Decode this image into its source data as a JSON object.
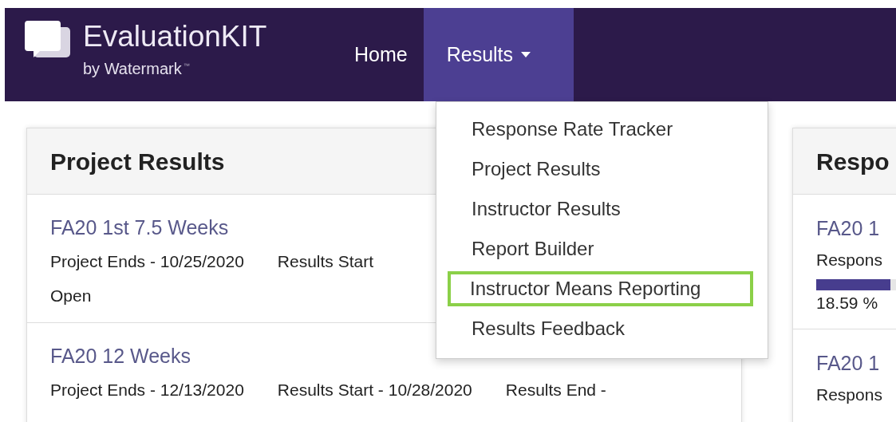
{
  "brand": {
    "name": "EvaluationKIT",
    "byline": "by Watermark",
    "trademark": "™"
  },
  "nav": [
    {
      "label": "Home",
      "selected": false,
      "dropdown": false
    },
    {
      "label": "Results",
      "selected": true,
      "dropdown": true
    }
  ],
  "dropdown_menu": [
    {
      "label": "Response Rate Tracker",
      "highlighted": false
    },
    {
      "label": "Project Results",
      "highlighted": false
    },
    {
      "label": "Instructor Results",
      "highlighted": false
    },
    {
      "label": "Report Builder",
      "highlighted": false
    },
    {
      "label": "Instructor Means Reporting",
      "highlighted": true
    },
    {
      "label": "Results Feedback",
      "highlighted": false
    }
  ],
  "project_results": {
    "title": "Project Results",
    "rows": [
      {
        "name": "FA20 1st 7.5 Weeks",
        "details": [
          "Project Ends - 10/25/2020",
          "Results Start"
        ],
        "status": "Open"
      },
      {
        "name": "FA20 12 Weeks",
        "details": [
          "Project Ends - 12/13/2020",
          "Results Start - 10/28/2020",
          "Results End -"
        ]
      }
    ]
  },
  "response_panel": {
    "title": "Respo",
    "rows": [
      {
        "name": "FA20 1",
        "label": "Respons",
        "level": 0.1859,
        "reading": "18.59 %"
      },
      {
        "name": "FA20 1",
        "label": "Respons"
      }
    ]
  }
}
